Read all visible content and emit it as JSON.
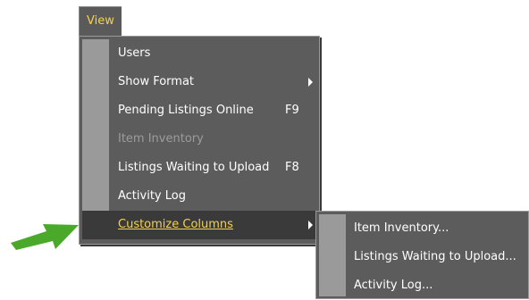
{
  "menubar": {
    "view_label": "View"
  },
  "view_menu": {
    "items": [
      {
        "label": "Users",
        "shortcut": "",
        "state": "normal"
      },
      {
        "label": "Show Format",
        "shortcut": "",
        "state": "normal",
        "submenu": true
      },
      {
        "label": "Pending Listings Online",
        "shortcut": "F9",
        "state": "normal"
      },
      {
        "label": "Item Inventory",
        "shortcut": "",
        "state": "disabled"
      },
      {
        "label": "Listings Waiting to Upload",
        "shortcut": "F8",
        "state": "normal"
      },
      {
        "label": "Activity Log",
        "shortcut": "",
        "state": "normal"
      },
      {
        "label": "Customize Columns",
        "shortcut": "",
        "state": "highlighted",
        "submenu": true
      }
    ]
  },
  "submenu": {
    "items": [
      {
        "label": "Item Inventory..."
      },
      {
        "label": "Listings Waiting to Upload..."
      },
      {
        "label": "Activity Log..."
      }
    ]
  },
  "annotation": {
    "icon": "green-arrow-icon",
    "color": "#4aa82a"
  },
  "colors": {
    "menu_bg": "#5c5c5c",
    "highlight_text": "#f4d24a",
    "highlight_bg": "#3a3a3a"
  }
}
